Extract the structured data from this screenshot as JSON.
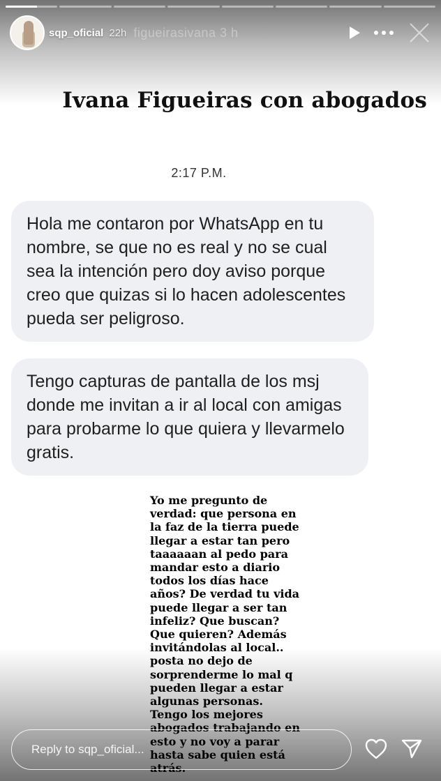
{
  "header": {
    "username": "sqp_oficial",
    "time_ago": "22h",
    "ghost_text": "figueirasivana   3 h",
    "icons": [
      "play-icon",
      "more-icon",
      "close-icon"
    ]
  },
  "progress": {
    "segments": 8,
    "active_index": 0,
    "active_fill": 0.6
  },
  "post": {
    "title": "Ivana Figueiras con abogados",
    "message_time": "2:17 P.M.",
    "message1": "Hola me contaron por WhatsApp en tu nombre, se que no es real y no se cual sea la intención pero doy aviso porque creo que quizas si lo hacen adolescentes pueda ser peligroso.",
    "message2": "Tengo capturas de pantalla de los msj donde me invitan a ir al local con amigas para probarme lo que quiera y llevarmelo gratis.",
    "caption": "Yo me pregunto de verdad: que persona en la faz de la tierra puede llegar a estar tan pero taaaaaan al pedo para mandar esto a diario todos los días hace años? De verdad tu vida puede llegar a ser tan infeliz? Que buscan? Que quieren? Además invitándolas al local.. posta no dejo de sorprenderme lo mal q pueden llegar a estar algunas personas. Tengo los mejores abogados trabajando en esto y no voy a parar hasta sabe quien está atrás."
  },
  "reply": {
    "placeholder": "Reply to sqp_oficial...",
    "icons": [
      "heart-icon",
      "send-icon"
    ]
  },
  "colors": {
    "bubble_bg": "#eef0f3",
    "text": "#111111",
    "overlay": "#000000"
  }
}
